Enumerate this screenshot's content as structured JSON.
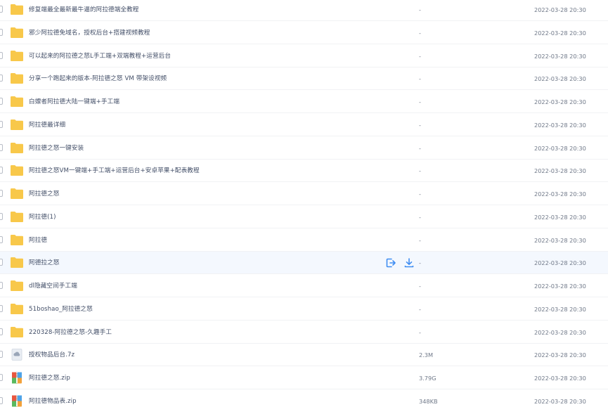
{
  "colors": {
    "folder": "#f8c84a",
    "hover_row": "#f4f8fe",
    "action_blue": "#3f8df2"
  },
  "hover_actions": {
    "share_icon": "share-icon",
    "download_icon": "download-icon"
  },
  "files": [
    {
      "name": "修复端最全最新最牛逼的阿拉德端全教程",
      "size": "-",
      "date": "2022-03-28 20:30",
      "type": "folder",
      "hover": false
    },
    {
      "name": "邪少阿拉德免域名，授权后台+搭建视频教程",
      "size": "-",
      "date": "2022-03-28 20:30",
      "type": "folder",
      "hover": false
    },
    {
      "name": "可以起来的阿拉德之怒L手工端+双端教程+运营后台",
      "size": "-",
      "date": "2022-03-28 20:30",
      "type": "folder",
      "hover": false
    },
    {
      "name": "分享一个跑起来的版本-阿拉德之怒 VM 带架设视频",
      "size": "-",
      "date": "2022-03-28 20:30",
      "type": "folder",
      "hover": false
    },
    {
      "name": "白嫖者阿拉德大陆一键端+手工端",
      "size": "-",
      "date": "2022-03-28 20:30",
      "type": "folder",
      "hover": false
    },
    {
      "name": "阿拉德最详细",
      "size": "-",
      "date": "2022-03-28 20:30",
      "type": "folder",
      "hover": false
    },
    {
      "name": "阿拉德之怒一键安装",
      "size": "-",
      "date": "2022-03-28 20:30",
      "type": "folder",
      "hover": false
    },
    {
      "name": "阿拉德之怒VM一键端+手工端+运营后台+安卓苹果+配表教程",
      "size": "-",
      "date": "2022-03-28 20:30",
      "type": "folder",
      "hover": false
    },
    {
      "name": "阿拉德之怒",
      "size": "-",
      "date": "2022-03-28 20:30",
      "type": "folder",
      "hover": false
    },
    {
      "name": "阿拉德(1)",
      "size": "-",
      "date": "2022-03-28 20:30",
      "type": "folder",
      "hover": false
    },
    {
      "name": "阿拉德",
      "size": "-",
      "date": "2022-03-28 20:30",
      "type": "folder",
      "hover": false
    },
    {
      "name": "阿德拉之怒",
      "size": "-",
      "date": "2022-03-28 20:30",
      "type": "folder",
      "hover": true
    },
    {
      "name": "dl隐藏空间手工端",
      "size": "-",
      "date": "2022-03-28 20:30",
      "type": "folder",
      "hover": false
    },
    {
      "name": "51boshao_阿拉德之怒",
      "size": "-",
      "date": "2022-03-28 20:30",
      "type": "folder",
      "hover": false
    },
    {
      "name": "220328-阿拉德之怒-久趣手工",
      "size": "-",
      "date": "2022-03-28 20:30",
      "type": "folder",
      "hover": false
    },
    {
      "name": "授权物品后台.7z",
      "size": "2.3M",
      "date": "2022-03-28 20:30",
      "type": "archive-7z",
      "hover": false
    },
    {
      "name": "阿拉德之怒.zip",
      "size": "3.79G",
      "date": "2022-03-28 20:30",
      "type": "archive-zip",
      "hover": false
    },
    {
      "name": "阿拉德物品表.zip",
      "size": "348KB",
      "date": "2022-03-28 20:30",
      "type": "archive-zip",
      "hover": false
    }
  ]
}
